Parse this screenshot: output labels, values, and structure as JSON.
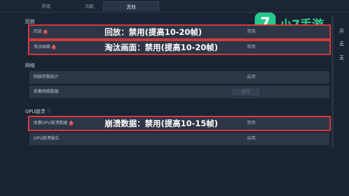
{
  "tabs": [
    {
      "label": "界面",
      "active": false
    },
    {
      "label": "功能",
      "active": false
    },
    {
      "label": "其他",
      "active": true
    }
  ],
  "logo": {
    "mark": "7",
    "text": "小7手游",
    "color": "#25c98a"
  },
  "sections": {
    "replay": {
      "title": "回放",
      "rows": [
        {
          "label": "回放",
          "badge": "!",
          "value": "禁用",
          "overlay": "回放：禁用(提高10-20帧)"
        },
        {
          "label": "淘汰画面",
          "badge": "?",
          "value": "禁用",
          "overlay": "淘汰画面：禁用(提高10-20帧)"
        }
      ]
    },
    "network": {
      "title": "网络",
      "rows": [
        {
          "label": "网络参数统计",
          "value": "启用"
        },
        {
          "label": "采集网络数据",
          "value": "运行"
        }
      ]
    },
    "gpu": {
      "title": "GPU崩溃",
      "info": "ⓘ",
      "rows": [
        {
          "label": "收集GPU崩溃数据",
          "badge": "?",
          "value": "禁用",
          "overlay": "崩溃数据：禁用(提高10-15帧)"
        },
        {
          "label": "GPU崩溃报告",
          "value": "启用"
        }
      ]
    }
  },
  "right_col": {
    "line1": "开",
    "line2": "无",
    "line3": "无"
  },
  "colors": {
    "highlight": "#d33a3a",
    "background": "#1a2333",
    "row": "#2c3647"
  }
}
